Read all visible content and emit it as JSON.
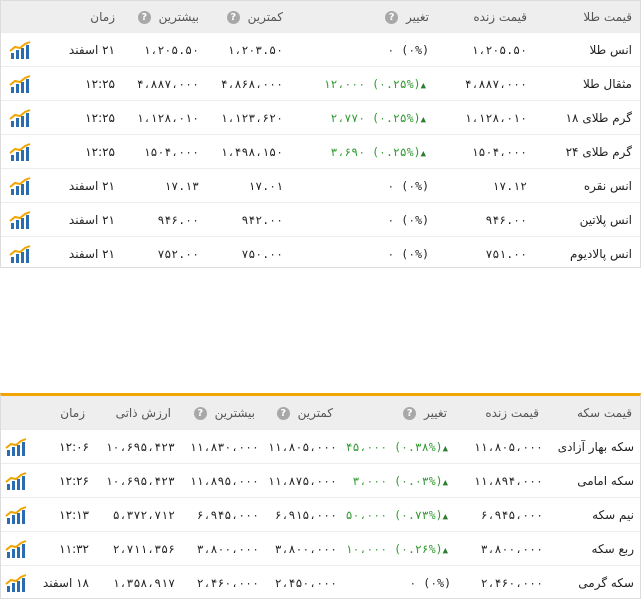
{
  "gold": {
    "headers": [
      "قیمت طلا",
      "قیمت زنده",
      "تغییر",
      "کمترین",
      "بیشترین",
      "زمان"
    ],
    "rows": [
      {
        "name": "انس طلا",
        "live": "۱،۲۰۵.۵۰",
        "change": "(۰%) ۰",
        "low": "۱،۲۰۳.۵۰",
        "high": "۱،۲۰۵.۵۰",
        "time": "۲۱ اسفند",
        "up": false
      },
      {
        "name": "مثقال طلا",
        "live": "۴،۸۸۷،۰۰۰",
        "change": "(۰.۲۵%) ۱۲،۰۰۰",
        "low": "۴،۸۶۸،۰۰۰",
        "high": "۴،۸۸۷،۰۰۰",
        "time": "۱۲:۲۵",
        "up": true
      },
      {
        "name": "گرم طلای ۱۸",
        "live": "۱،۱۲۸،۰۱۰",
        "change": "(۰.۲۵%) ۲،۷۷۰",
        "low": "۱،۱۲۳،۶۲۰",
        "high": "۱،۱۲۸،۰۱۰",
        "time": "۱۲:۲۵",
        "up": true
      },
      {
        "name": "گرم طلای ۲۴",
        "live": "۱۵۰۴،۰۰۰",
        "change": "(۰.۲۵%) ۳،۶۹۰",
        "low": "۱،۴۹۸،۱۵۰",
        "high": "۱۵۰۴،۰۰۰",
        "time": "۱۲:۲۵",
        "up": true
      },
      {
        "name": "انس نقره",
        "live": "۱۷.۱۲",
        "change": "(۰%) ۰",
        "low": "۱۷.۰۱",
        "high": "۱۷.۱۳",
        "time": "۲۱ اسفند",
        "up": false
      },
      {
        "name": "انس پلاتین",
        "live": "۹۴۶.۰۰",
        "change": "(۰%) ۰",
        "low": "۹۴۲.۰۰",
        "high": "۹۴۶.۰۰",
        "time": "۲۱ اسفند",
        "up": false
      },
      {
        "name": "انس پالادیوم",
        "live": "۷۵۱.۰۰",
        "change": "(۰%) ۰",
        "low": "۷۵۰.۰۰",
        "high": "۷۵۲.۰۰",
        "time": "۲۱ اسفند",
        "up": false
      }
    ]
  },
  "coins": {
    "headers": [
      "قیمت سکه",
      "قیمت زنده",
      "تغییر",
      "کمترین",
      "بیشترین",
      "ارزش ذاتی",
      "زمان"
    ],
    "rows": [
      {
        "name": "سکه بهار آزادی",
        "live": "۱۱،۸۰۵،۰۰۰",
        "change": "(۰.۳۸%) ۴۵،۰۰۰",
        "low": "۱۱،۸۰۵،۰۰۰",
        "high": "۱۱،۸۳۰،۰۰۰",
        "intrinsic": "۱۰،۶۹۵،۴۲۳",
        "time": "۱۲:۰۶",
        "up": true
      },
      {
        "name": "سکه امامی",
        "live": "۱۱،۸۹۴،۰۰۰",
        "change": "(۰.۰۳%) ۳،۰۰۰",
        "low": "۱۱،۸۷۵،۰۰۰",
        "high": "۱۱،۸۹۵،۰۰۰",
        "intrinsic": "۱۰،۶۹۵،۴۲۳",
        "time": "۱۲:۲۶",
        "up": true
      },
      {
        "name": "نیم سکه",
        "live": "۶،۹۴۵،۰۰۰",
        "change": "(۰.۷۳%) ۵۰،۰۰۰",
        "low": "۶،۹۱۵،۰۰۰",
        "high": "۶،۹۴۵،۰۰۰",
        "intrinsic": "۵،۳۷۲،۷۱۲",
        "time": "۱۲:۱۳",
        "up": true
      },
      {
        "name": "ربع سکه",
        "live": "۳،۸۰۰،۰۰۰",
        "change": "(۰.۲۶%) ۱۰،۰۰۰",
        "low": "۳،۸۰۰،۰۰۰",
        "high": "۳،۸۰۰،۰۰۰",
        "intrinsic": "۲،۷۱۱،۳۵۶",
        "time": "۱۱:۳۲",
        "up": true
      },
      {
        "name": "سکه گرمی",
        "live": "۲،۴۶۰،۰۰۰",
        "change": "(۰%) ۰",
        "low": "۲،۴۵۰،۰۰۰",
        "high": "۲،۴۶۰،۰۰۰",
        "intrinsic": "۱،۳۵۸،۹۱۷",
        "time": "۱۸ اسفند",
        "up": false
      }
    ]
  },
  "icons": {
    "chart": "chart-icon",
    "info": "info-icon",
    "up": "arrow-up-icon"
  },
  "colors": {
    "accent": "#f0a500",
    "positive": "#2e9a2e",
    "header_bg": "#eeeeee"
  }
}
